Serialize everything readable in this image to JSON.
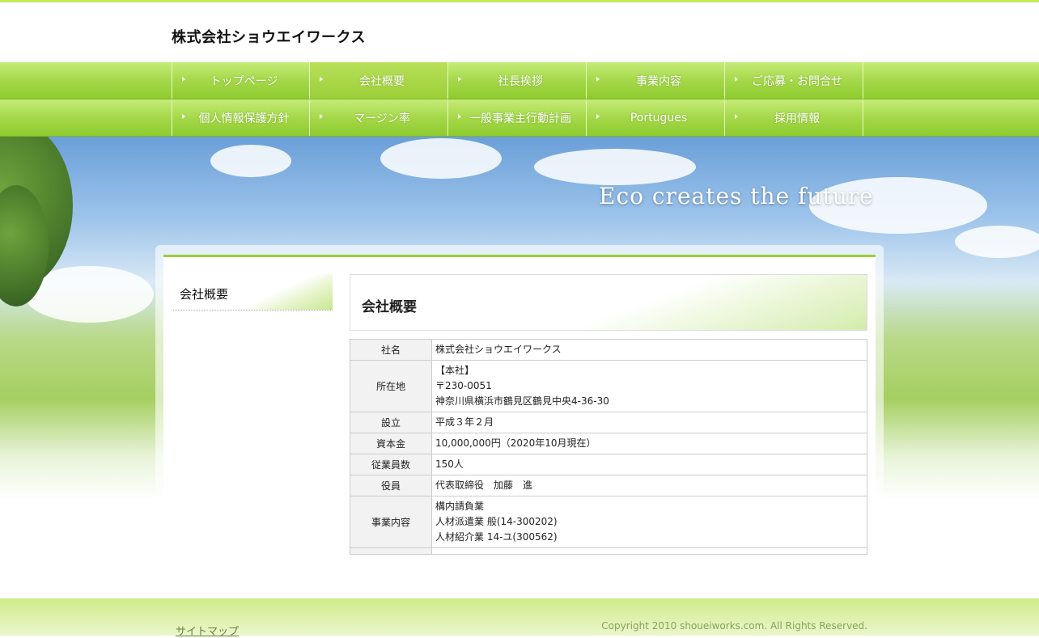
{
  "site": {
    "title": "株式会社ショウエイワークス"
  },
  "nav": {
    "row1": [
      {
        "label": "トップページ"
      },
      {
        "label": "会社概要",
        "active": true
      },
      {
        "label": "社長挨拶"
      },
      {
        "label": "事業内容"
      },
      {
        "label": "ご応募・お問合せ"
      }
    ],
    "row2": [
      {
        "label": "個人情報保護方針"
      },
      {
        "label": "マージン率"
      },
      {
        "label": "一般事業主行動計画"
      },
      {
        "label": "Portugues"
      },
      {
        "label": "採用情報"
      }
    ]
  },
  "hero": {
    "tagline": "Eco creates the future"
  },
  "sidebar": {
    "title": "会社概要"
  },
  "main": {
    "title": "会社概要",
    "table": [
      {
        "label": "社名",
        "lines": [
          "株式会社ショウエイワークス"
        ]
      },
      {
        "label": "所在地",
        "lines": [
          "【本社】",
          "〒230-0051",
          "神奈川県横浜市鶴見区鶴見中央4-36-30"
        ]
      },
      {
        "label": "設立",
        "lines": [
          "平成３年２月"
        ]
      },
      {
        "label": "資本金",
        "lines": [
          "10,000,000円（2020年10月現在）"
        ]
      },
      {
        "label": "従業員数",
        "lines": [
          "150人"
        ]
      },
      {
        "label": "役員",
        "lines": [
          "代表取締役　加藤　進"
        ]
      },
      {
        "label": "事業内容",
        "lines": [
          "構内請負業",
          "人材派遣業 般(14-300202)",
          "人材紹介業 14‐ユ(300562)"
        ]
      },
      {
        "label": "",
        "lines": [
          ""
        ]
      }
    ]
  },
  "footer": {
    "sitemap": "サイトマップ",
    "copyright": "Copyright 2010 shoueiworks.com. All Rights Reserved."
  },
  "colors": {
    "accent": "#9bcf3d",
    "nav_bg": "#a5d84a",
    "top_strip": "#c3ea5a"
  }
}
